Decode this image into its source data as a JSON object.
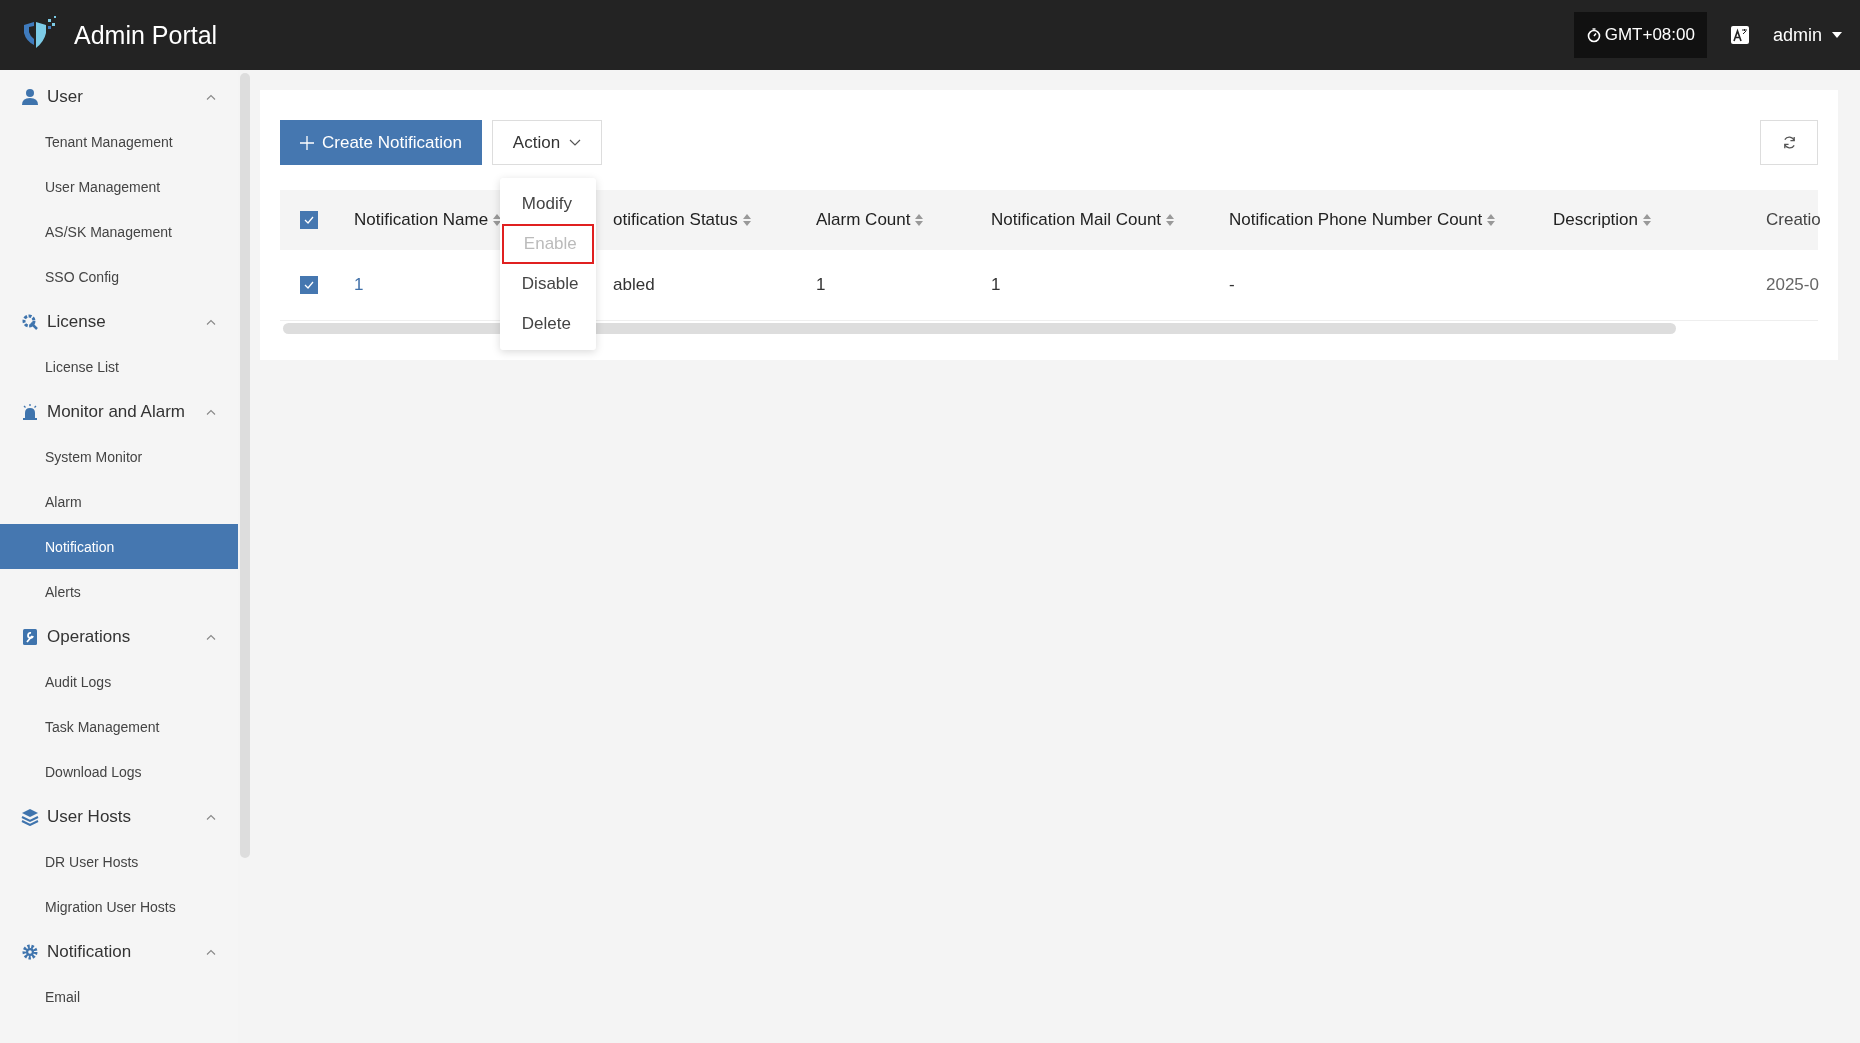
{
  "header": {
    "title": "Admin Portal",
    "timezone": "GMT+08:00",
    "user": "admin"
  },
  "sidebar": {
    "groups": [
      {
        "label": "User",
        "kind": "user",
        "expanded": true,
        "items": [
          {
            "label": "Tenant Management",
            "selected": false
          },
          {
            "label": "User Management",
            "selected": false
          },
          {
            "label": "AS/SK Management",
            "selected": false
          },
          {
            "label": "SSO Config",
            "selected": false
          }
        ]
      },
      {
        "label": "License",
        "kind": "license",
        "expanded": true,
        "items": [
          {
            "label": "License List",
            "selected": false
          }
        ]
      },
      {
        "label": "Monitor and Alarm",
        "kind": "alarm",
        "expanded": true,
        "items": [
          {
            "label": "System Monitor",
            "selected": false
          },
          {
            "label": "Alarm",
            "selected": false
          },
          {
            "label": "Notification",
            "selected": true
          },
          {
            "label": "Alerts",
            "selected": false
          }
        ]
      },
      {
        "label": "Operations",
        "kind": "operations",
        "expanded": true,
        "items": [
          {
            "label": "Audit Logs",
            "selected": false
          },
          {
            "label": "Task Management",
            "selected": false
          },
          {
            "label": "Download Logs",
            "selected": false
          }
        ]
      },
      {
        "label": "User Hosts",
        "kind": "hosts",
        "expanded": true,
        "items": [
          {
            "label": "DR User Hosts",
            "selected": false
          },
          {
            "label": "Migration User Hosts",
            "selected": false
          }
        ]
      },
      {
        "label": "Notification",
        "kind": "notification",
        "expanded": true,
        "items": [
          {
            "label": "Email",
            "selected": false
          }
        ]
      }
    ]
  },
  "toolbar": {
    "create_button": "Create Notification",
    "action_button": "Action"
  },
  "action_menu": [
    {
      "label": "Modify",
      "disabled": false,
      "highlighted": false
    },
    {
      "label": "Enable",
      "disabled": true,
      "highlighted": true
    },
    {
      "label": "Disable",
      "disabled": false,
      "highlighted": false
    },
    {
      "label": "Delete",
      "disabled": false,
      "highlighted": false
    }
  ],
  "table": {
    "all_checked": true,
    "columns": [
      {
        "label": "Notification Name",
        "sortable": true
      },
      {
        "label": "otification Status",
        "sortable": true
      },
      {
        "label": "Alarm Count",
        "sortable": true
      },
      {
        "label": "Notification Mail Count",
        "sortable": true
      },
      {
        "label": "Notification Phone Number Count",
        "sortable": true
      },
      {
        "label": "Description",
        "sortable": true
      },
      {
        "label": "Creatio",
        "sortable": false
      }
    ],
    "rows": [
      {
        "checked": true,
        "cells": [
          "1",
          "abled",
          "1",
          "1",
          "-",
          "",
          "2025-0"
        ]
      }
    ]
  }
}
